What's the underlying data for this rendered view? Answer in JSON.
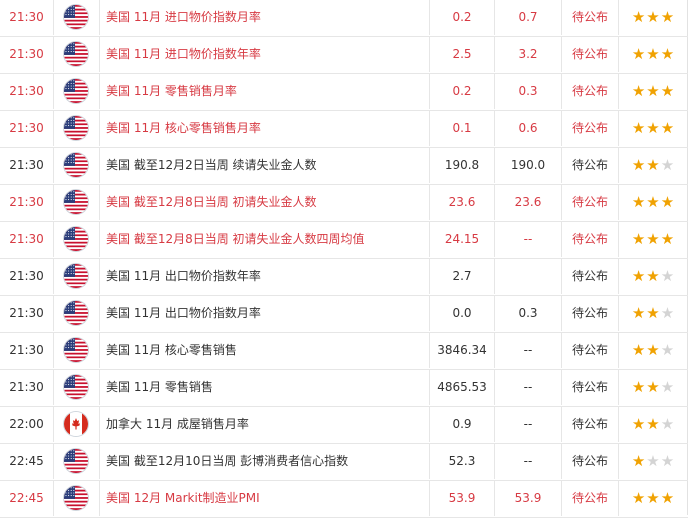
{
  "colors": {
    "highlight_text": "#d73a43",
    "normal_text": "#333333",
    "star_on": "#f0a202",
    "star_off": "#d4d4d4"
  },
  "events": [
    {
      "time": "21:30",
      "country_icon": "us-flag-icon",
      "event": "美国 11月 进口物价指数月率",
      "previous": "0.2",
      "forecast": "0.7",
      "actual": "待公布",
      "importance": 3,
      "highlight": true
    },
    {
      "time": "21:30",
      "country_icon": "us-flag-icon",
      "event": "美国 11月 进口物价指数年率",
      "previous": "2.5",
      "forecast": "3.2",
      "actual": "待公布",
      "importance": 3,
      "highlight": true
    },
    {
      "time": "21:30",
      "country_icon": "us-flag-icon",
      "event": "美国 11月 零售销售月率",
      "previous": "0.2",
      "forecast": "0.3",
      "actual": "待公布",
      "importance": 3,
      "highlight": true
    },
    {
      "time": "21:30",
      "country_icon": "us-flag-icon",
      "event": "美国 11月 核心零售销售月率",
      "previous": "0.1",
      "forecast": "0.6",
      "actual": "待公布",
      "importance": 3,
      "highlight": true
    },
    {
      "time": "21:30",
      "country_icon": "us-flag-icon",
      "event": "美国 截至12月2日当周 续请失业金人数",
      "previous": "190.8",
      "forecast": "190.0",
      "actual": "待公布",
      "importance": 2,
      "highlight": false
    },
    {
      "time": "21:30",
      "country_icon": "us-flag-icon",
      "event": "美国 截至12月8日当周 初请失业金人数",
      "previous": "23.6",
      "forecast": "23.6",
      "actual": "待公布",
      "importance": 3,
      "highlight": true
    },
    {
      "time": "21:30",
      "country_icon": "us-flag-icon",
      "event": "美国 截至12月8日当周 初请失业金人数四周均值",
      "previous": "24.15",
      "forecast": "--",
      "actual": "待公布",
      "importance": 3,
      "highlight": true
    },
    {
      "time": "21:30",
      "country_icon": "us-flag-icon",
      "event": "美国 11月 出口物价指数年率",
      "previous": "2.7",
      "forecast": "",
      "actual": "待公布",
      "importance": 2,
      "highlight": false
    },
    {
      "time": "21:30",
      "country_icon": "us-flag-icon",
      "event": "美国 11月 出口物价指数月率",
      "previous": "0.0",
      "forecast": "0.3",
      "actual": "待公布",
      "importance": 2,
      "highlight": false
    },
    {
      "time": "21:30",
      "country_icon": "us-flag-icon",
      "event": "美国 11月 核心零售销售",
      "previous": "3846.34",
      "forecast": "--",
      "actual": "待公布",
      "importance": 2,
      "highlight": false
    },
    {
      "time": "21:30",
      "country_icon": "us-flag-icon",
      "event": "美国 11月 零售销售",
      "previous": "4865.53",
      "forecast": "--",
      "actual": "待公布",
      "importance": 2,
      "highlight": false
    },
    {
      "time": "22:00",
      "country_icon": "canada-flag-icon",
      "event": "加拿大 11月 成屋销售月率",
      "previous": "0.9",
      "forecast": "--",
      "actual": "待公布",
      "importance": 2,
      "highlight": false
    },
    {
      "time": "22:45",
      "country_icon": "us-flag-icon",
      "event": "美国 截至12月10日当周 彭博消费者信心指数",
      "previous": "52.3",
      "forecast": "--",
      "actual": "待公布",
      "importance": 1,
      "highlight": false
    },
    {
      "time": "22:45",
      "country_icon": "us-flag-icon",
      "event": "美国 12月 Markit制造业PMI",
      "previous": "53.9",
      "forecast": "53.9",
      "actual": "待公布",
      "importance": 3,
      "highlight": true
    }
  ]
}
